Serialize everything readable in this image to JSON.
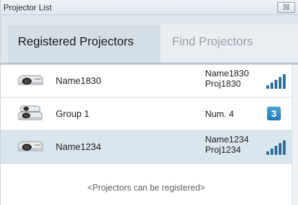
{
  "window": {
    "title": "Projector List",
    "close_label": "☒"
  },
  "tabs": [
    {
      "label": "Registered Projectors",
      "active": true
    },
    {
      "label": "Find Projectors",
      "active": false
    }
  ],
  "rows": [
    {
      "name": "Name1830",
      "info_line1": "Name1830",
      "info_line2": "Proj1830",
      "indicator": "signal-icon",
      "selected": false
    },
    {
      "name": "Group 1",
      "info": "Num. 4",
      "count": "3",
      "indicator": "count-badge",
      "selected": false
    },
    {
      "name": "Name1234",
      "info_line1": "Name1234",
      "info_line2": "Proj1234",
      "indicator": "signal-icon",
      "selected": true
    }
  ],
  "footer": {
    "hint": "<Projectors can be registered>"
  },
  "colors": {
    "selected_row": "#dae6ee",
    "accent": "#1f7ab6",
    "signal": "#2f6f96"
  }
}
